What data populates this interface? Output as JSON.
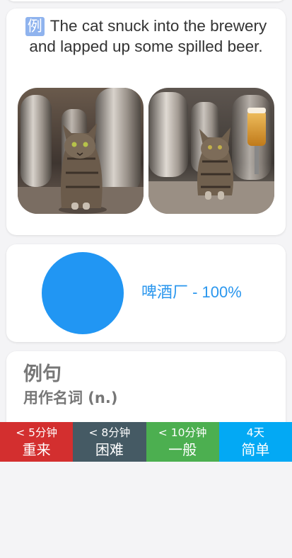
{
  "example": {
    "badge": "例",
    "sentence": "The cat snuck into the brewery and lapped up some spilled beer."
  },
  "progress": {
    "label": "啤酒厂 - 100%",
    "percent": 100,
    "color": "#2196F3"
  },
  "sentences": {
    "title": "例句",
    "subtitle": "用作名词 (n.)"
  },
  "answers": [
    {
      "time": "< 5分钟",
      "label": "重来",
      "color": "#d32f2f"
    },
    {
      "time": "< 8分钟",
      "label": "困难",
      "color": "#455a64"
    },
    {
      "time": "< 10分钟",
      "label": "一般",
      "color": "#4caf50"
    },
    {
      "time": "4天",
      "label": "简单",
      "color": "#03a9f4"
    }
  ]
}
